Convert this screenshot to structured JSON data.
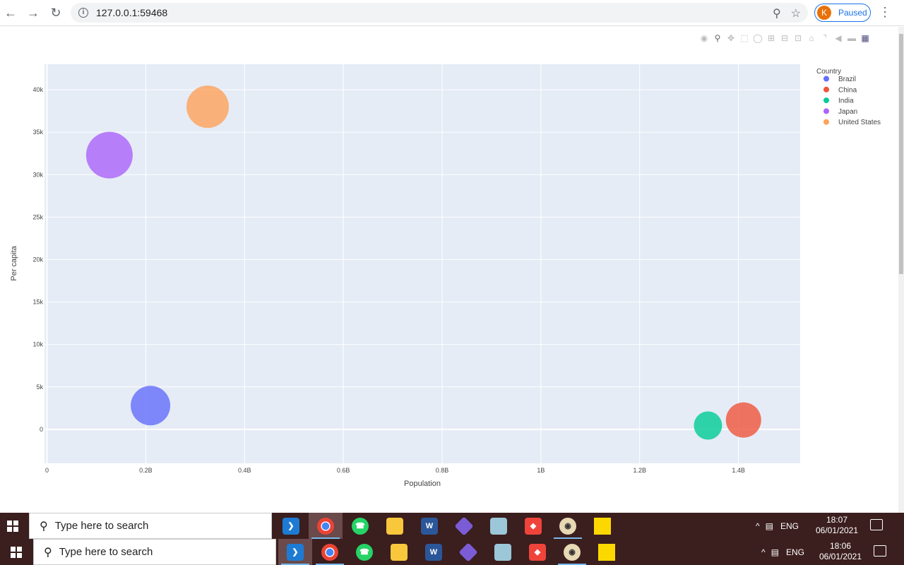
{
  "browser": {
    "url": "127.0.0.1:59468",
    "profile_initial": "K",
    "profile_status": "Paused"
  },
  "chart_data": {
    "type": "scatter",
    "xlabel": "Population",
    "ylabel": "Per capita",
    "xlim": [
      -0.005,
      1.525
    ],
    "ylim": [
      -4000,
      43000
    ],
    "x_tick_values": [
      0,
      0.2,
      0.4,
      0.6,
      0.8,
      1.0,
      1.2,
      1.4
    ],
    "x_tick_labels": [
      "0",
      "0.2B",
      "0.4B",
      "0.6B",
      "0.8B",
      "1B",
      "1.2B",
      "1.4B"
    ],
    "y_tick_values": [
      0,
      5000,
      10000,
      15000,
      20000,
      25000,
      30000,
      35000,
      40000
    ],
    "y_tick_labels": [
      "0",
      "5k",
      "10k",
      "15k",
      "20k",
      "25k",
      "30k",
      "35k",
      "40k"
    ],
    "x_unit": "billions",
    "legend_title": "Country",
    "legend_position": "right",
    "grid": true,
    "series": [
      {
        "name": "Brazil",
        "color": "#636efa",
        "x": 0.2096,
        "y": 2800,
        "size": 28
      },
      {
        "name": "China",
        "color": "#ef553b",
        "x": 1.4103,
        "y": 1100,
        "size": 25
      },
      {
        "name": "India",
        "color": "#00cc96",
        "x": 1.3383,
        "y": 450,
        "size": 20
      },
      {
        "name": "Japan",
        "color": "#ab63fa",
        "x": 0.1264,
        "y": 32300,
        "size": 33
      },
      {
        "name": "United States",
        "color": "#ffa15a",
        "x": 0.3254,
        "y": 38000,
        "size": 30
      }
    ]
  },
  "taskbar": {
    "search_placeholder": "Type here to search",
    "lang": "ENG",
    "top_time": "18:07",
    "top_date": "06/01/2021",
    "bottom_time": "18:06",
    "bottom_date": "06/01/2021"
  }
}
